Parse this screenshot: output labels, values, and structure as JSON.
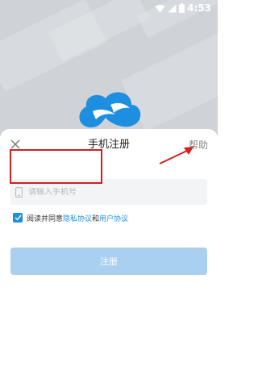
{
  "status_bar": {
    "time": "4:53",
    "icons": [
      "wifi-icon",
      "signal-icon",
      "battery-icon"
    ]
  },
  "logo": "cloud-logo-icon",
  "dialog": {
    "title": "手机注册",
    "close_icon": "close-icon",
    "help_label": "帮助"
  },
  "phone_input": {
    "icon": "phone-icon",
    "placeholder": "请输入手机号",
    "value": ""
  },
  "agreement": {
    "checked": true,
    "prefix": "阅读并同意",
    "privacy_link": "隐私协议",
    "conjunction": "和",
    "user_link": "用户协议"
  },
  "register_button": {
    "label": "注册",
    "enabled": false
  },
  "colors": {
    "accent": "#1e8ee0",
    "button_disabled": "#a9d0ef",
    "annotation_red": "#d21f1f"
  }
}
